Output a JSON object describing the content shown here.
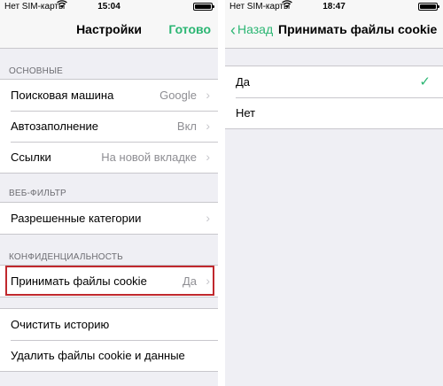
{
  "left": {
    "status": {
      "carrier": "Нет SIM-карты",
      "time": "15:04"
    },
    "nav": {
      "title": "Настройки",
      "done": "Готово"
    },
    "sections": {
      "general": {
        "header": "ОСНОВНЫЕ",
        "rows": [
          {
            "label": "Поисковая машина",
            "value": "Google"
          },
          {
            "label": "Автозаполнение",
            "value": "Вкл"
          },
          {
            "label": "Ссылки",
            "value": "На новой вкладке"
          }
        ]
      },
      "webfilter": {
        "header": "ВЕБ-ФИЛЬТР",
        "rows": [
          {
            "label": "Разрешенные категории"
          }
        ]
      },
      "privacy": {
        "header": "КОНФИДЕНЦИАЛЬНОСТЬ",
        "rows": [
          {
            "label": "Принимать файлы cookie",
            "value": "Да"
          }
        ]
      },
      "actions": {
        "rows": [
          {
            "label": "Очистить историю"
          },
          {
            "label": "Удалить файлы cookie и данные"
          }
        ]
      }
    },
    "highlight_color": "#c0282d"
  },
  "right": {
    "status": {
      "carrier": "Нет SIM-карты",
      "time": "18:47"
    },
    "nav": {
      "back": "Назад",
      "title": "Принимать файлы cookie"
    },
    "options": [
      {
        "label": "Да",
        "selected": true
      },
      {
        "label": "Нет",
        "selected": false
      }
    ]
  },
  "colors": {
    "accent": "#2bb673",
    "background": "#efeff4"
  },
  "icons": [
    "wifi-icon",
    "battery-icon",
    "chevron-right-icon",
    "chevron-left-icon",
    "checkmark-icon"
  ]
}
